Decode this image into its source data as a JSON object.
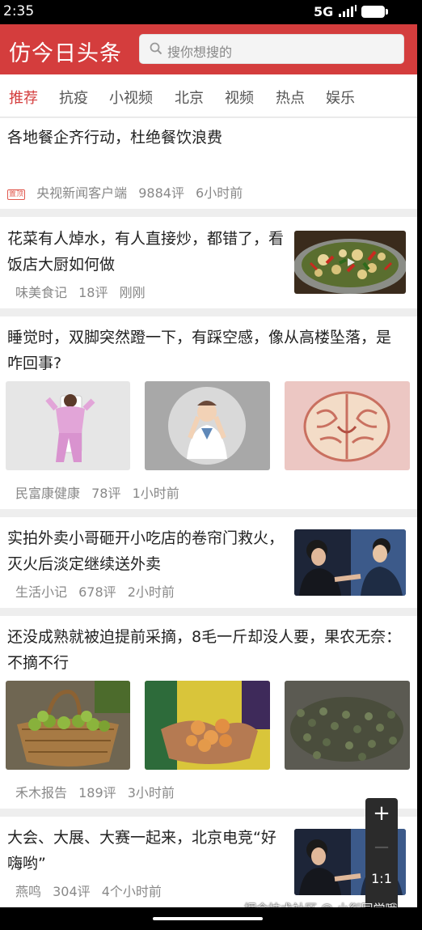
{
  "status_bar": {
    "time": "2:35",
    "network": "5G"
  },
  "header": {
    "title": "仿今日头条",
    "search_placeholder": "搜你想搜的"
  },
  "tabs": [
    "推荐",
    "抗疫",
    "小视频",
    "北京",
    "视频",
    "热点",
    "娱乐"
  ],
  "active_tab": "推荐",
  "feed": [
    {
      "title": "各地餐企齐行动，杜绝餐饮浪费",
      "badge": "置顶",
      "source": "央视新闻客户端",
      "comments": "9884评",
      "time": "6小时前"
    },
    {
      "title": "花菜有人焯水，有人直接炒，都错了，看饭店大厨如何做",
      "source": "味美食记",
      "comments": "18评",
      "time": "刚刚",
      "thumbnail": "stir-fried-cauliflower"
    },
    {
      "title": "睡觉时，双脚突然蹬一下，有踩空感，像从高楼坠落，是咋回事?",
      "source": "民富康健康",
      "comments": "78评",
      "time": "1小时前",
      "images": [
        "person-illustration",
        "doctor-illustration",
        "brain-illustration"
      ]
    },
    {
      "title": "实拍外卖小哥砸开小吃店的卷帘门救火，灭火后淡定继续送外卖",
      "source": "生活小记",
      "comments": "678评",
      "time": "2小时前",
      "thumbnail": "tv-drama-still"
    },
    {
      "title": "还没成熟就被迫提前采摘，8毛一斤却没人要，果农无奈：不摘不行",
      "source": "禾木报告",
      "comments": "189评",
      "time": "3小时前",
      "images": [
        "basket-of-green-fruit",
        "hands-holding-fruit",
        "pile-of-green-fruit"
      ]
    },
    {
      "title": "大会、大展、大赛一起来，北京电竞“好嗨哟”",
      "source": "燕鸣",
      "comments": "304评",
      "time": "4个小时前",
      "thumbnail": "tv-drama-still"
    }
  ],
  "zoom_control": {
    "plus": "+",
    "minus": "−",
    "ratio": "1:1"
  },
  "watermark": "掘金技术社区 @ 小衔同学哦",
  "colors": {
    "brand_red": "#d43d3d",
    "text": "#222222",
    "meta": "#888888"
  }
}
